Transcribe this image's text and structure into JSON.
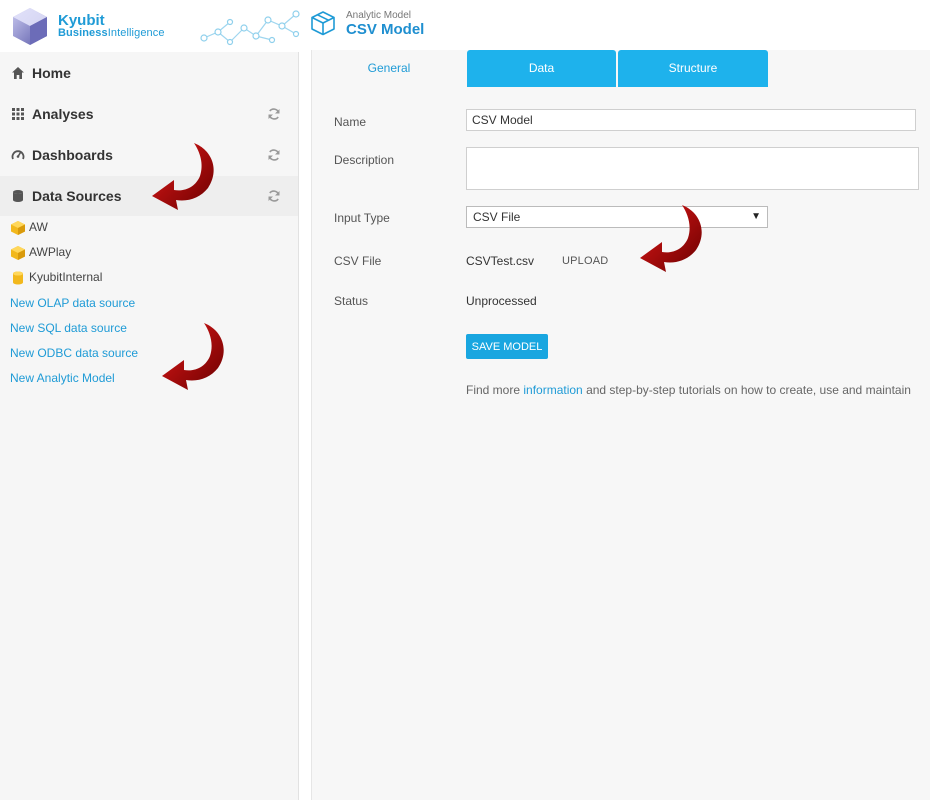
{
  "brand": {
    "name": "Kyubit",
    "subtitle_part1": "Business",
    "subtitle_part2": "Intelligence"
  },
  "header": {
    "kicker": "Analytic Model",
    "title": "CSV Model"
  },
  "sidebar": {
    "nav": [
      {
        "label": "Home",
        "icon": "home-icon",
        "refresh": false
      },
      {
        "label": "Analyses",
        "icon": "grid-icon",
        "refresh": true
      },
      {
        "label": "Dashboards",
        "icon": "gauge-icon",
        "refresh": true
      },
      {
        "label": "Data Sources",
        "icon": "database-icon",
        "refresh": true
      }
    ],
    "data_sources": [
      {
        "label": "AW",
        "icon": "cube-icon"
      },
      {
        "label": "AWPlay",
        "icon": "cube-icon"
      },
      {
        "label": "KyubitInternal",
        "icon": "database-icon"
      }
    ],
    "links": [
      "New OLAP data source",
      "New SQL data source",
      "New ODBC data source",
      "New Analytic Model"
    ]
  },
  "tabs": [
    {
      "label": "General",
      "active": true
    },
    {
      "label": "Data",
      "active": false
    },
    {
      "label": "Structure",
      "active": false
    }
  ],
  "form": {
    "name_label": "Name",
    "name_value": "CSV Model",
    "description_label": "Description",
    "description_value": "",
    "input_type_label": "Input Type",
    "input_type_value": "CSV File",
    "csv_file_label": "CSV File",
    "csv_file_value": "CSVTest.csv",
    "upload_label": "UPLOAD",
    "status_label": "Status",
    "status_value": "Unprocessed",
    "save_label": "SAVE MODEL"
  },
  "info": {
    "prefix": "Find more ",
    "link": "information",
    "suffix": " and step-by-step tutorials on how to create, use and maintain"
  },
  "colors": {
    "accent": "#1eb2ec",
    "link": "#1f9bd6",
    "arrow": "#b00000"
  }
}
